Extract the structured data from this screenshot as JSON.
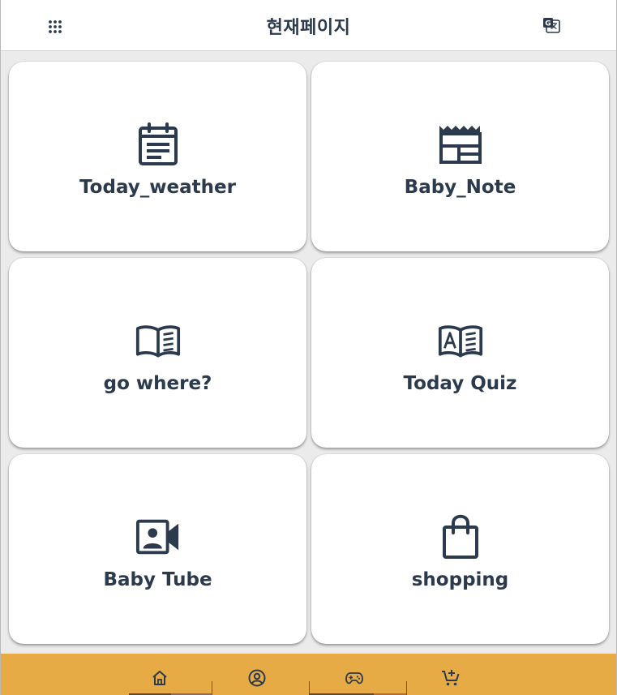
{
  "header": {
    "title": "현재페이지",
    "menu_icon": "apps-grid-icon",
    "translate_icon": "translate-icon"
  },
  "cards": [
    {
      "label": "Today_weather",
      "icon": "calendar-icon"
    },
    {
      "label": "Baby_Note",
      "icon": "newspaper-icon"
    },
    {
      "label": "go where?",
      "icon": "open-book-icon"
    },
    {
      "label": "Today Quiz",
      "icon": "book-letter-a-icon"
    },
    {
      "label": "Baby Tube",
      "icon": "video-contact-icon"
    },
    {
      "label": "shopping",
      "icon": "shopping-bag-icon"
    }
  ],
  "bottom_nav": {
    "items": [
      {
        "icon": "home-icon"
      },
      {
        "icon": "account-icon"
      },
      {
        "icon": "gamepad-icon"
      },
      {
        "icon": "cart-add-icon"
      }
    ]
  },
  "colors": {
    "header_bg": "#ffffff",
    "page_bg": "#ebebeb",
    "text": "#2c3a4d",
    "nav_bg": "#e6ab45"
  }
}
